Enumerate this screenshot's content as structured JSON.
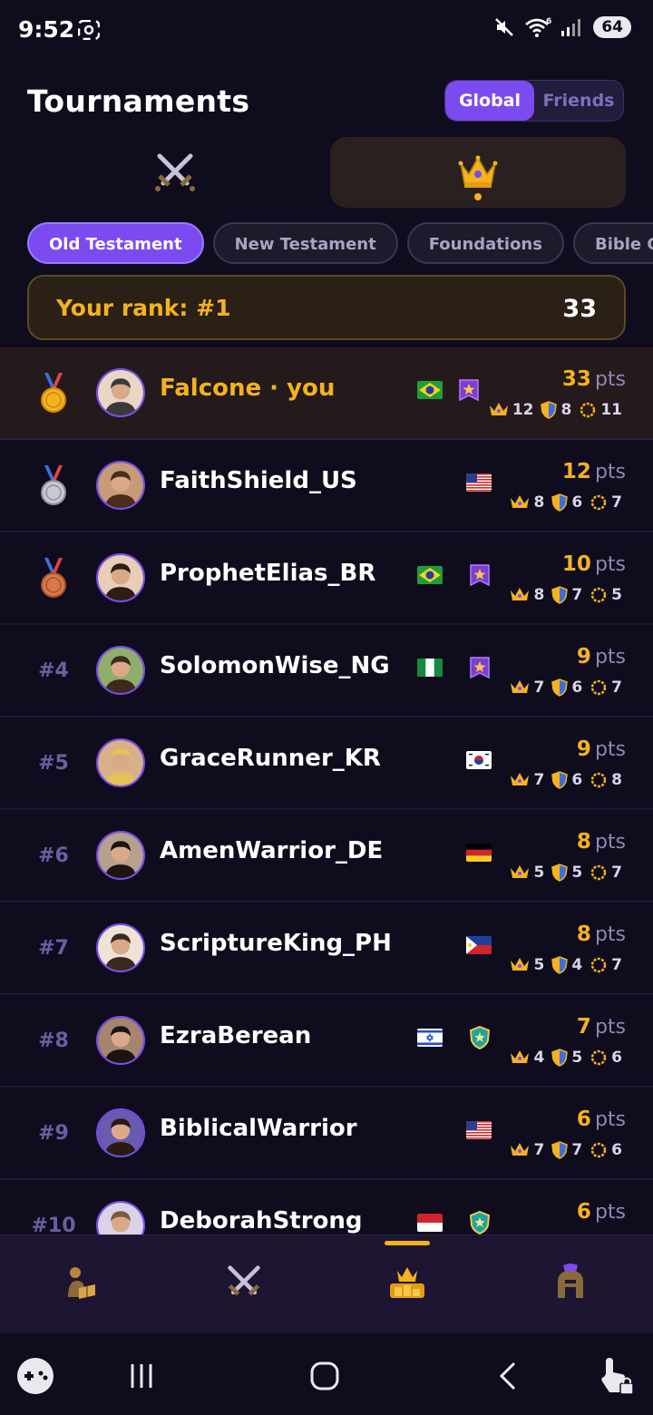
{
  "status": {
    "time": "9:52",
    "wifi_label": "6",
    "battery": "64"
  },
  "header": {
    "title": "Tournaments",
    "scope_options": [
      "Global",
      "Friends"
    ],
    "scope_selected": "Global"
  },
  "mode_tabs": [
    {
      "icon": "crossed-swords-icon",
      "selected": false
    },
    {
      "icon": "crown-icon",
      "selected": true
    }
  ],
  "categories": [
    {
      "label": "Old Testament",
      "active": true
    },
    {
      "label": "New Testament",
      "active": false
    },
    {
      "label": "Foundations",
      "active": false
    },
    {
      "label": "Bible Co",
      "active": false
    }
  ],
  "your_rank": {
    "label": "Your rank: #1",
    "score": "33"
  },
  "leaderboard": [
    {
      "rank": "1",
      "rank_display": "gold-medal-icon",
      "name": "Falcone · you",
      "flag": "brazil",
      "badge": "purple-star-badge",
      "points": "33",
      "pts_label": "pts",
      "crowns": "12",
      "shields": "8",
      "wreaths": "11",
      "is_me": true
    },
    {
      "rank": "2",
      "rank_display": "silver-medal-icon",
      "name": "FaithShield_US",
      "flag": "usa",
      "badge": "",
      "points": "12",
      "pts_label": "pts",
      "crowns": "8",
      "shields": "6",
      "wreaths": "7",
      "is_me": false
    },
    {
      "rank": "3",
      "rank_display": "bronze-medal-icon",
      "name": "ProphetElias_BR",
      "flag": "brazil",
      "badge": "purple-star-badge",
      "points": "10",
      "pts_label": "pts",
      "crowns": "8",
      "shields": "7",
      "wreaths": "5",
      "is_me": false
    },
    {
      "rank": "#4",
      "rank_display": "text",
      "name": "SolomonWise_NG",
      "flag": "nigeria",
      "badge": "purple-star-badge",
      "points": "9",
      "pts_label": "pts",
      "crowns": "7",
      "shields": "6",
      "wreaths": "7",
      "is_me": false
    },
    {
      "rank": "#5",
      "rank_display": "text",
      "name": "GraceRunner_KR",
      "flag": "korea",
      "badge": "",
      "points": "9",
      "pts_label": "pts",
      "crowns": "7",
      "shields": "6",
      "wreaths": "8",
      "is_me": false
    },
    {
      "rank": "#6",
      "rank_display": "text",
      "name": "AmenWarrior_DE",
      "flag": "germany",
      "badge": "",
      "points": "8",
      "pts_label": "pts",
      "crowns": "5",
      "shields": "5",
      "wreaths": "7",
      "is_me": false
    },
    {
      "rank": "#7",
      "rank_display": "text",
      "name": "ScriptureKing_PH",
      "flag": "philippines",
      "badge": "",
      "points": "8",
      "pts_label": "pts",
      "crowns": "5",
      "shields": "4",
      "wreaths": "7",
      "is_me": false
    },
    {
      "rank": "#8",
      "rank_display": "text",
      "name": "EzraBerean",
      "flag": "israel",
      "badge": "teal-shield-badge",
      "points": "7",
      "pts_label": "pts",
      "crowns": "4",
      "shields": "5",
      "wreaths": "6",
      "is_me": false
    },
    {
      "rank": "#9",
      "rank_display": "text",
      "name": "BiblicalWarrior",
      "flag": "usa",
      "badge": "",
      "points": "6",
      "pts_label": "pts",
      "crowns": "7",
      "shields": "7",
      "wreaths": "6",
      "is_me": false
    },
    {
      "rank": "#10",
      "rank_display": "text",
      "name": "DeborahStrong",
      "flag": "indonesia",
      "badge": "teal-shield-badge",
      "points": "6",
      "pts_label": "pts",
      "crowns": "",
      "shields": "",
      "wreaths": "",
      "is_me": false
    }
  ],
  "bottom_nav": [
    {
      "icon": "reading-person-icon",
      "selected": false
    },
    {
      "icon": "crossed-swords-icon",
      "selected": false
    },
    {
      "icon": "trophy-crown-icon",
      "selected": true
    },
    {
      "icon": "spartan-helmet-icon",
      "selected": false
    }
  ],
  "colors": {
    "background": "#0f0c1e",
    "accent": "#7b4bf0",
    "gold": "#f5b21f",
    "muted": "#8f88b2"
  }
}
